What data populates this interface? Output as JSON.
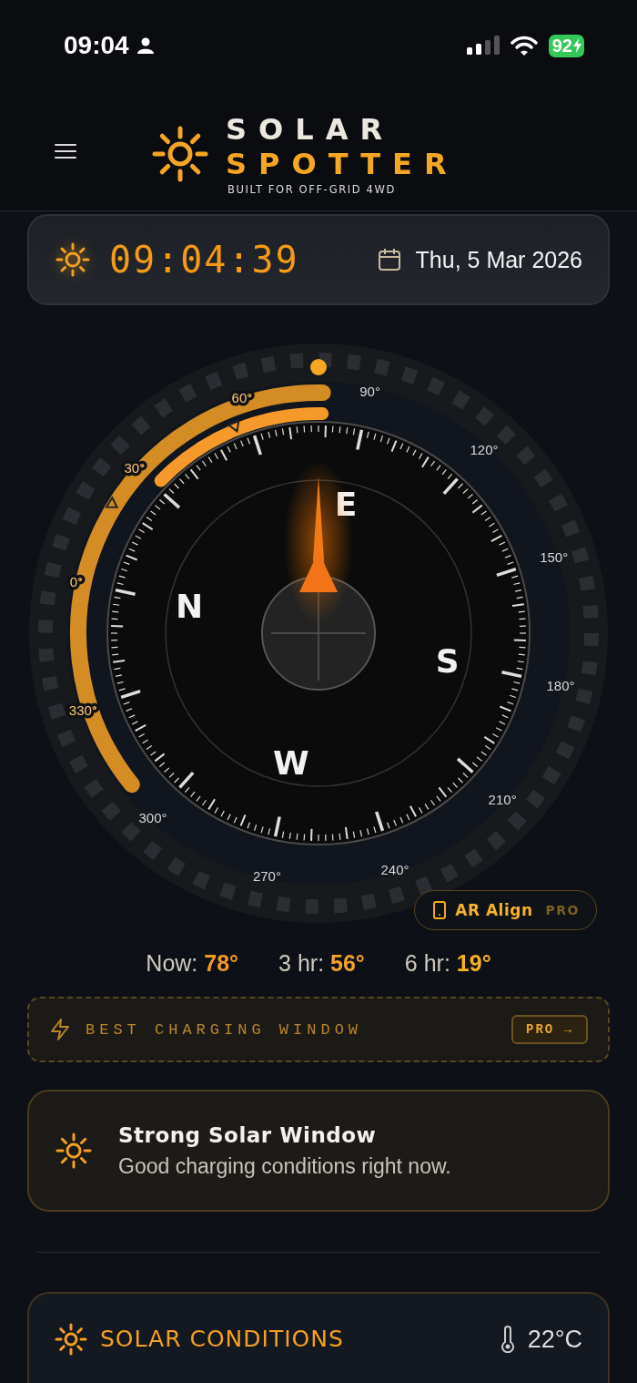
{
  "status_bar": {
    "time": "09:04",
    "battery": "92"
  },
  "header": {
    "title_line_1": "SOLAR",
    "title_line_2": "SPOTTER",
    "tagline": "BUILT FOR OFF-GRID 4WD"
  },
  "clock_card": {
    "time": "09:04:39",
    "date": "Thu, 5 Mar 2026"
  },
  "compass": {
    "cardinals": [
      "N",
      "E",
      "S",
      "W"
    ],
    "degree_labels": [
      {
        "text": "0°",
        "in_window": true
      },
      {
        "text": "30°",
        "in_window": true
      },
      {
        "text": "60°",
        "in_window": true
      },
      {
        "text": "90°",
        "in_window": false
      },
      {
        "text": "120°",
        "in_window": false
      },
      {
        "text": "150°",
        "in_window": false
      },
      {
        "text": "180°",
        "in_window": false
      },
      {
        "text": "210°",
        "in_window": false
      },
      {
        "text": "240°",
        "in_window": false
      },
      {
        "text": "270°",
        "in_window": false
      },
      {
        "text": "300°",
        "in_window": false
      },
      {
        "text": "330°",
        "in_window": true
      }
    ]
  },
  "ar_button": {
    "label": "AR Align",
    "badge": "PRO"
  },
  "forecast": [
    {
      "label": "Now:",
      "value": "78°",
      "color": "#f29a1e"
    },
    {
      "label": "3 hr:",
      "value": "56°",
      "color": "#f2a22a"
    },
    {
      "label": "6 hr:",
      "value": "19°",
      "color": "#f7b21c"
    }
  ],
  "best_window": {
    "label": "BEST CHARGING WINDOW",
    "button": "PRO →"
  },
  "alert": {
    "title": "Strong Solar Window",
    "message": "Good charging conditions right now."
  },
  "conditions": {
    "title": "SOLAR CONDITIONS",
    "temperature": "22°C"
  }
}
